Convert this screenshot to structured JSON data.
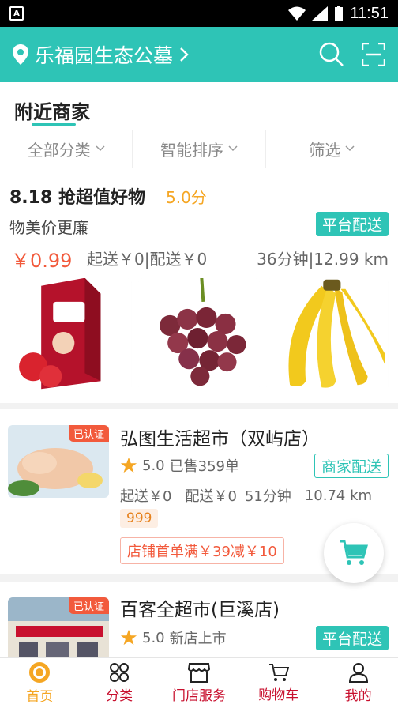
{
  "status_bar": {
    "time": "11:51",
    "app_badge": "A"
  },
  "header": {
    "location": "乐福园生态公墓"
  },
  "nearby": {
    "title": "附近商家",
    "filters": [
      "全部分类",
      "智能排序",
      "筛选"
    ]
  },
  "promo_store": {
    "name": "8.18 抢超值好物",
    "score": "5.0分",
    "slogan": "物美价更廉",
    "delivery_badge": "平台配送",
    "price": "￥0.99",
    "delivery_info": "起送￥0|配送￥0",
    "distance": "36分钟|12.99 km",
    "products": [
      "milk-drink",
      "grapes",
      "bananas"
    ]
  },
  "stores": [
    {
      "cert": "已认证",
      "name": "弘图生活超市（双屿店）",
      "rating": "5.0",
      "sales": "已售359单",
      "delivery_badge": "商家配送",
      "min_order": "起送￥0",
      "delivery_fee": "配送￥0",
      "time": "51分钟",
      "distance": "10.74 km",
      "tag": "999",
      "promo": "店铺首单满￥39减￥10"
    },
    {
      "cert": "已认证",
      "name": "百客全超市(巨溪店)",
      "rating": "5.0",
      "sales": "新店上市",
      "delivery_badge": "平台配送"
    }
  ],
  "tabbar": {
    "items": [
      {
        "label": "首页",
        "icon": "home-logo-icon"
      },
      {
        "label": "分类",
        "icon": "grid-icon"
      },
      {
        "label": "门店服务",
        "icon": "store-icon"
      },
      {
        "label": "购物车",
        "icon": "cart-icon"
      },
      {
        "label": "我的",
        "icon": "user-icon"
      }
    ]
  },
  "colors": {
    "primary": "#2ec4b6",
    "price": "#f25a3c",
    "accent": "#f5a623",
    "tab_text": "#c8102e"
  }
}
